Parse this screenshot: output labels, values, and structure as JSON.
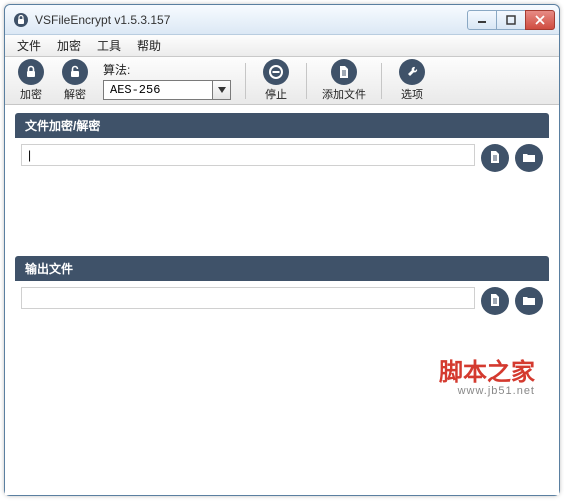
{
  "window": {
    "title": "VSFileEncrypt v1.5.3.157"
  },
  "menu": {
    "file": "文件",
    "encrypt": "加密",
    "tools": "工具",
    "help": "帮助"
  },
  "toolbar": {
    "encrypt": "加密",
    "decrypt": "解密",
    "algo_label": "算法:",
    "algo_value": "AES-256",
    "stop": "停止",
    "addfile": "添加文件",
    "options": "选项"
  },
  "panel": {
    "file_header": "文件加密/解密",
    "file_value": "|",
    "output_header": "输出文件",
    "output_value": ""
  },
  "watermark": {
    "text": "脚本之家",
    "url": "www.jb51.net"
  }
}
